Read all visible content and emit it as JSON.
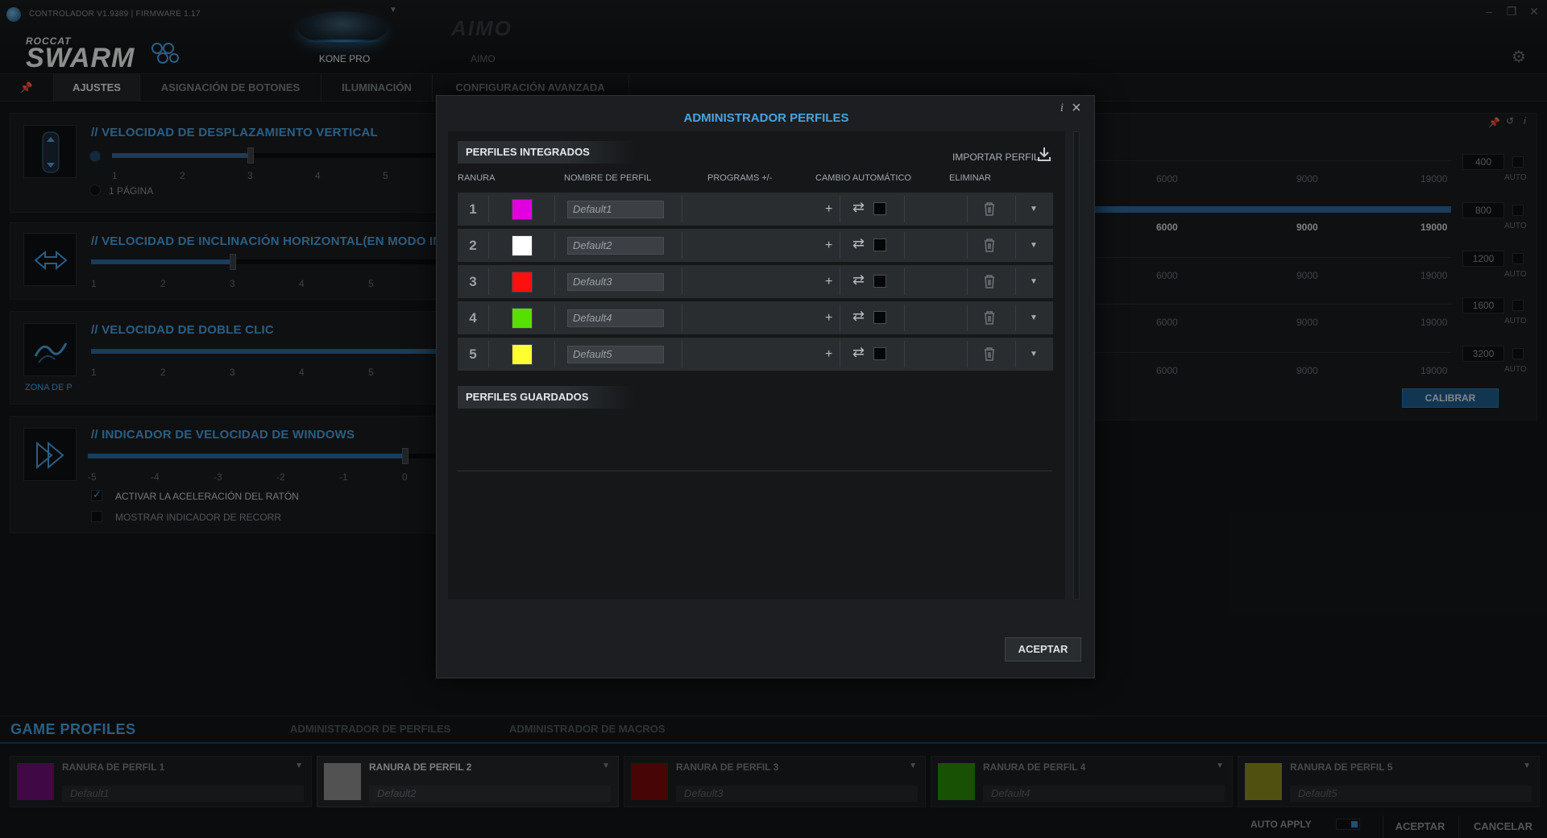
{
  "header": {
    "version": "CONTROLADOR V1.9389 | FIRMWARE 1.17",
    "brand_top": "ROCCAT",
    "brand_main": "SWARM",
    "devices": [
      {
        "label": "KONE PRO",
        "active": true
      },
      {
        "label": "AIMO",
        "logo": "AIMO",
        "active": false
      }
    ],
    "window_buttons": [
      "minimize",
      "restore",
      "close"
    ]
  },
  "tabs": [
    {
      "label": "",
      "icon": "pin-icon"
    },
    {
      "label": "AJUSTES",
      "active": true
    },
    {
      "label": "ASIGNACIÓN DE BOTONES"
    },
    {
      "label": "ILUMINACIÓN"
    },
    {
      "label": "CONFIGURACIÓN AVANZADA"
    }
  ],
  "settings": {
    "vertical_scroll": {
      "title": "// VELOCIDAD DE DESPLAZAMIENTO VERTICAL",
      "ticks": [
        "1",
        "2",
        "3",
        "4",
        "5"
      ],
      "value": 3,
      "page_option": "1 PÁGINA"
    },
    "horizontal_tilt": {
      "title": "// VELOCIDAD DE INCLINACIÓN HORIZONTAL(EN MODO INCLI",
      "ticks": [
        "1",
        "2",
        "3",
        "4",
        "5"
      ],
      "value": 3
    },
    "double_click": {
      "title": "// VELOCIDAD DE DOBLE CLIC",
      "ticks": [
        "1",
        "2",
        "3",
        "4",
        "5"
      ],
      "zone_label": "ZONA DE P"
    },
    "windows_speed": {
      "title": "// INDICADOR DE VELOCIDAD DE WINDOWS",
      "ticks": [
        "-5",
        "-4",
        "-3",
        "-2",
        "-1",
        "0"
      ],
      "value": 0,
      "accel_label": "ACTIVAR LA ACELERACIÓN DEL RATÓN",
      "accel_checked": true,
      "trail_label": "MOSTRAR INDICADOR DE RECORR",
      "trail_checked": false
    },
    "dpi": {
      "rows": [
        {
          "ticks": [
            "6000",
            "9000",
            "19000"
          ],
          "value": "400",
          "auto": "AUTO"
        },
        {
          "ticks": [
            "6000",
            "9000",
            "19000"
          ],
          "value": "800",
          "auto": "AUTO",
          "active": true
        },
        {
          "ticks": [
            "6000",
            "9000",
            "19000"
          ],
          "value": "1200",
          "auto": "AUTO"
        },
        {
          "ticks": [
            "6000",
            "9000",
            "19000"
          ],
          "value": "1600",
          "auto": "AUTO"
        },
        {
          "ticks": [
            "6000",
            "9000",
            "19000"
          ],
          "value": "3200",
          "auto": "AUTO"
        }
      ],
      "calibrate_label": "CALIBRAR"
    }
  },
  "modal": {
    "title": "ADMINISTRADOR PERFILES",
    "integrated_header": "PERFILES INTEGRADOS",
    "import_label": "IMPORTAR PERFIL",
    "columns": {
      "slot": "RANURA",
      "name": "NOMBRE DE PERFIL",
      "programs": "PROGRAMS +/-",
      "auto_switch": "CAMBIO AUTOMÁTICO",
      "delete": "ELIMINAR"
    },
    "profiles": [
      {
        "slot": "1",
        "color": "#e000e0",
        "name": "Default1"
      },
      {
        "slot": "2",
        "color": "#ffffff",
        "name": "Default2"
      },
      {
        "slot": "3",
        "color": "#ff1010",
        "name": "Default3"
      },
      {
        "slot": "4",
        "color": "#55e000",
        "name": "Default4"
      },
      {
        "slot": "5",
        "color": "#ffff30",
        "name": "Default5"
      }
    ],
    "saved_header": "PERFILES GUARDADOS",
    "accept_label": "ACEPTAR"
  },
  "bottom": {
    "title": "GAME PROFILES",
    "tabs": [
      "ADMINISTRADOR DE PERFILES",
      "ADMINISTRADOR DE MACROS"
    ],
    "slots": [
      {
        "label": "RANURA DE PERFIL 1",
        "name": "Default1",
        "color": "#6e0f78"
      },
      {
        "label": "RANURA DE PERFIL 2",
        "name": "Default2",
        "color": "#8e8e8e",
        "active": true
      },
      {
        "label": "RANURA DE PERFIL 3",
        "name": "Default3",
        "color": "#7a0a0a"
      },
      {
        "label": "RANURA DE PERFIL 4",
        "name": "Default4",
        "color": "#2a8a08"
      },
      {
        "label": "RANURA DE PERFIL 5",
        "name": "Default5",
        "color": "#8a8a1c"
      }
    ],
    "auto_apply_label": "AUTO APPLY",
    "auto_apply_on": true,
    "accept_label": "ACEPTAR",
    "cancel_label": "CANCELAR"
  },
  "colors": {
    "accent": "#4aa3de",
    "panel": "#1a1d20",
    "modal": "#1c1e21"
  }
}
